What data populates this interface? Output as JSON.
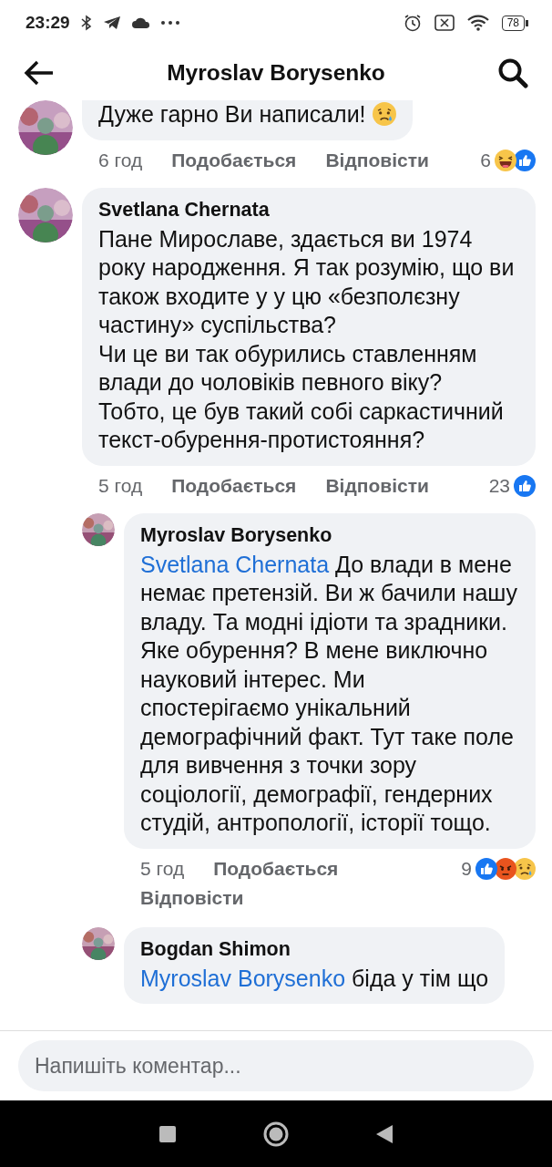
{
  "status_bar": {
    "time": "23:29",
    "battery": "78"
  },
  "header": {
    "title": "Myroslav Borysenko"
  },
  "comments": [
    {
      "text": "Дуже гарно Ви написали!",
      "trailing_emoji": {
        "kind": "sad"
      },
      "time": "6 год",
      "like_label": "Подобається",
      "reply_label": "Відповісти",
      "reaction_count": "6",
      "reactions": [
        {
          "kind": "haha"
        },
        {
          "kind": "like"
        }
      ]
    },
    {
      "author": "Svetlana Chernata",
      "text": "Пане Мирославе, здається ви 1974 року народження. Я так розумію, що ви також входите у у цю «безполєзну частину» суспільства?\nЧи це ви так обурились ставленням влади до чоловіків певного віку?\nТобто, це був такий собі саркастичний текст-обурення-протистояння?",
      "time": "5 год",
      "like_label": "Подобається",
      "reply_label": "Відповісти",
      "reaction_count": "23",
      "reactions": [
        {
          "kind": "like"
        }
      ],
      "children": [
        {
          "author": "Myroslav Borysenko",
          "mention": "Svetlana Chernata",
          "text": "До влади в мене немає претензій. Ви ж бачили нашу владу. Та модні ідіоти та зрадники. Яке обурення? В мене виключно науковий інтерес. Ми спостерігаємо унікальний демографічний факт. Тут таке поле для вивчення з точки зору соціології, демографії, гендерних студій, антропології, історії тощо.",
          "time": "5 год",
          "like_label": "Подобається",
          "reply_label": "Відповісти",
          "reaction_count": "9",
          "reactions": [
            {
              "kind": "like"
            },
            {
              "kind": "angry"
            },
            {
              "kind": "sad"
            }
          ]
        },
        {
          "author": "Bogdan Shimon",
          "mention": "Myroslav Borysenko",
          "text": "біда у тім що"
        }
      ]
    }
  ],
  "composer": {
    "placeholder": "Напишіть коментар..."
  }
}
